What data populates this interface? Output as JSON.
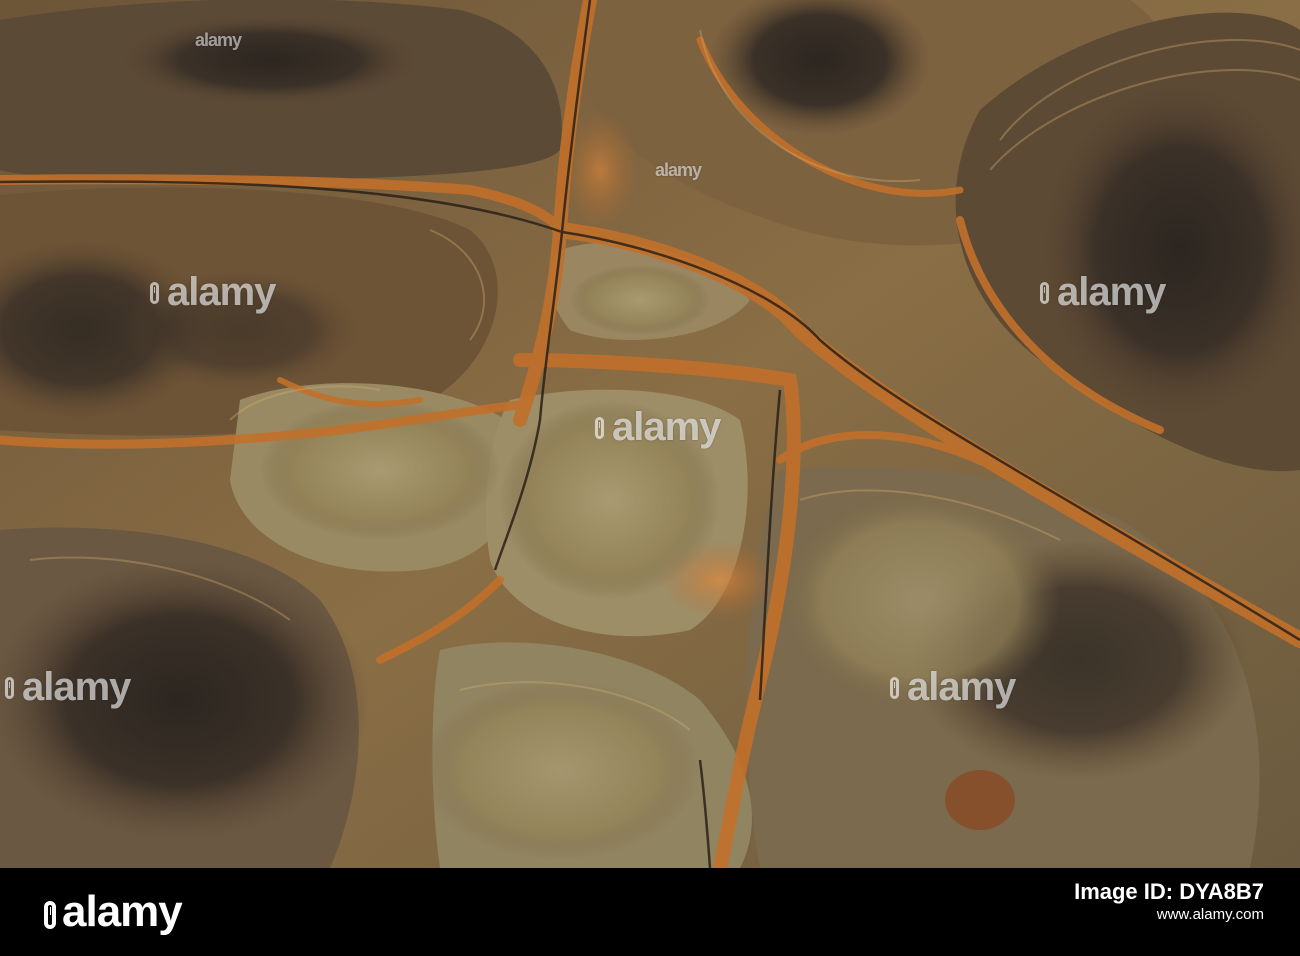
{
  "watermark": {
    "text": "alamy"
  },
  "footer": {
    "logo": "alamy",
    "image_id_label": "Image ID: DYA8B7",
    "url": "www.alamy.com"
  },
  "colors": {
    "dark_rock": "#3a2f24",
    "rust": "#c9782b",
    "sand": "#a7956b",
    "footer_bg": "#000000"
  }
}
